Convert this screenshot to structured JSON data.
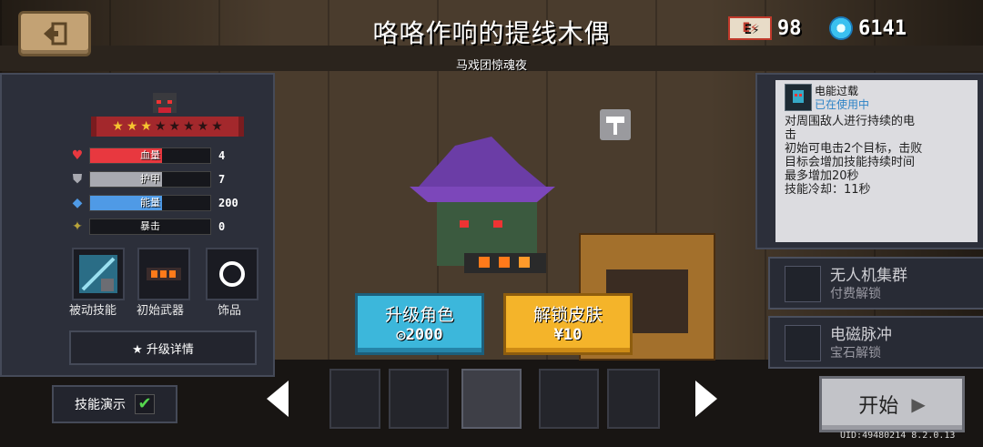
{
  "header": {
    "title": "咯咯作响的提线木偶",
    "subtitle": "马戏团惊魂夜",
    "energy_value": "98",
    "gems_value": "6141"
  },
  "character": {
    "stars_filled": 3,
    "stars_total": 8,
    "stats": [
      {
        "label": "血量",
        "value": "4",
        "icon": "heart-icon",
        "color": "#e8383f",
        "fill": 1.0
      },
      {
        "label": "护甲",
        "value": "7",
        "icon": "shield-icon",
        "color": "#a8a9b0",
        "fill": 1.0
      },
      {
        "label": "能量",
        "value": "200",
        "icon": "diamond-icon",
        "color": "#4f9ae6",
        "fill": 1.0
      },
      {
        "label": "暴击",
        "value": "0",
        "icon": "crit-icon",
        "color": "#b8a33a",
        "fill": 0
      }
    ],
    "slots": {
      "passive_label": "被动技能",
      "weapon_label": "初始武器",
      "accessory_label": "饰品"
    },
    "upgrade_details": "★ 升级详情"
  },
  "demo": {
    "label": "技能演示",
    "checked": true
  },
  "actions": {
    "upgrade_label": "升级角色",
    "upgrade_cost": "2000",
    "unlock_label": "解锁皮肤",
    "unlock_cost": "¥10"
  },
  "skill": {
    "name": "电能过载",
    "status": "已在使用中",
    "description": "对周围敌人进行持续的电\n击\n初始可电击2个目标，击败\n目标会增加技能持续时间\n最多增加20秒\n技能冷却：11秒"
  },
  "locked_skills": [
    {
      "name": "无人机集群",
      "status": "付费解锁"
    },
    {
      "name": "电磁脉冲",
      "status": "宝石解锁"
    }
  ],
  "footer": {
    "start_label": "开始",
    "uid": "UID:49480214 8.2.0.13"
  },
  "colors": {
    "upgrade": "#3cb7db",
    "unlock": "#f4b42a",
    "star_on": "#f6c430"
  }
}
